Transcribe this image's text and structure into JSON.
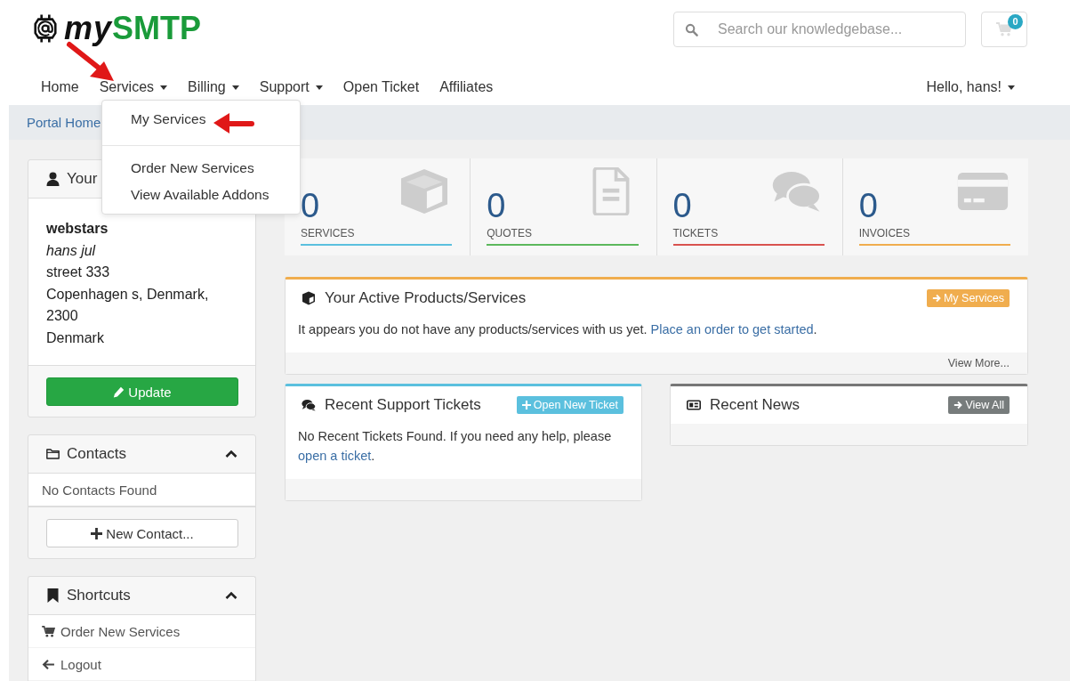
{
  "logo": {
    "prefix": "my",
    "brand": "SMTP"
  },
  "search": {
    "placeholder": "Search our knowledgebase..."
  },
  "cart": {
    "count": "0"
  },
  "nav": [
    {
      "label": "Home",
      "dropdown": false
    },
    {
      "label": "Services",
      "dropdown": true
    },
    {
      "label": "Billing",
      "dropdown": true
    },
    {
      "label": "Support",
      "dropdown": true
    },
    {
      "label": "Open Ticket",
      "dropdown": false
    },
    {
      "label": "Affiliates",
      "dropdown": false
    }
  ],
  "user_menu": {
    "label": "Hello, hans!"
  },
  "services_menu": {
    "groups": [
      [
        "My Services"
      ],
      [
        "Order New Services",
        "View Available Addons"
      ]
    ]
  },
  "breadcrumb": {
    "label": "Portal Home"
  },
  "info_panel": {
    "title": "Your",
    "lines": [
      "webstars",
      "hans jul",
      "street 333",
      "Copenhagen s, Denmark,",
      "2300",
      "Denmark"
    ],
    "button": "Update"
  },
  "contacts_panel": {
    "title": "Contacts",
    "expanded": true,
    "empty_text": "No Contacts Found",
    "button": "New Contact..."
  },
  "shortcuts_panel": {
    "title": "Shortcuts",
    "expanded": true,
    "items": [
      {
        "kind": "cart",
        "label": "Order New Services"
      },
      {
        "kind": "back",
        "label": "Logout"
      }
    ]
  },
  "stats": [
    {
      "kind": "cube",
      "value": "0",
      "label": "SERVICES",
      "color": "#5bc0de"
    },
    {
      "kind": "document",
      "value": "0",
      "label": "QUOTES",
      "color": "#5cb85c"
    },
    {
      "kind": "chat",
      "value": "0",
      "label": "TICKETS",
      "color": "#d9534f"
    },
    {
      "kind": "card",
      "value": "0",
      "label": "INVOICES",
      "color": "#f0ad4e"
    }
  ],
  "products_panel": {
    "title": "Your Active Products/Services",
    "button": "My Services",
    "text": "It appears you do not have any products/services with us yet.",
    "link": "Place an order to get started",
    "after": ".",
    "footer_link": "View More..."
  },
  "tickets_panel": {
    "title": "Recent Support Tickets",
    "button": "Open New Ticket",
    "text": "No Recent Tickets Found. If you need any help, please",
    "link": "open a ticket",
    "after": "."
  },
  "news_panel": {
    "title": "Recent News",
    "button": "View All"
  }
}
